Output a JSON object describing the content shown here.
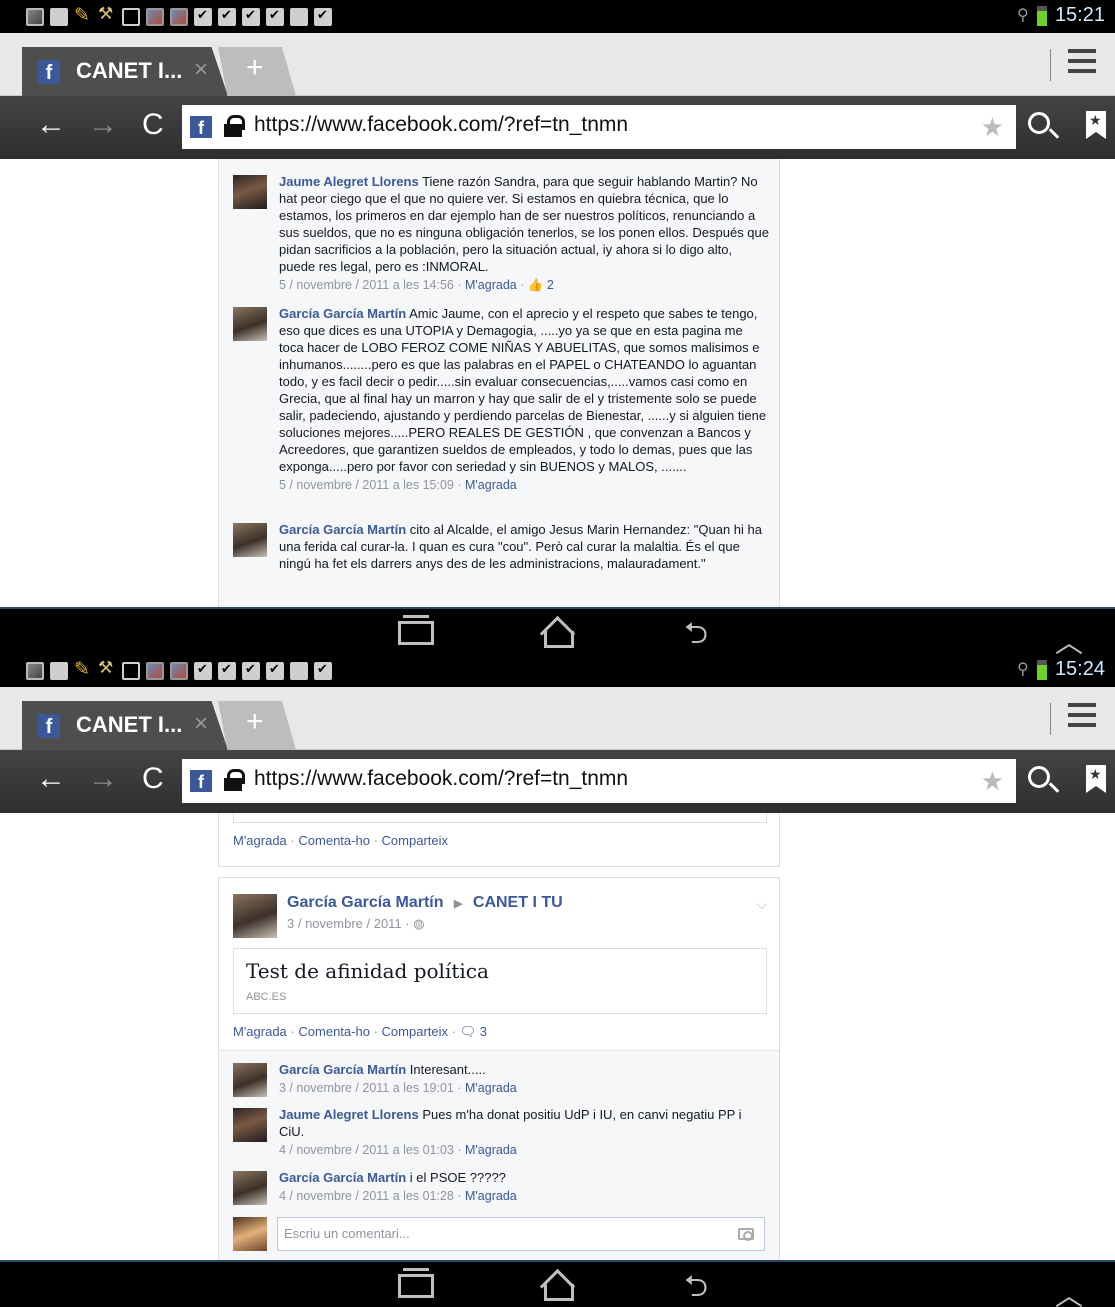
{
  "screens": [
    {
      "status": {
        "time": "15:21"
      },
      "tab": {
        "favicon": "f",
        "title": "CANET I...",
        "close": "×",
        "new": "+"
      },
      "omnibox": {
        "url": "https://www.facebook.com/?ref=tn_tnmn"
      },
      "comments": [
        {
          "author": "Jaume Alegret Llorens",
          "text": "Tiene razón Sandra, para que seguir hablando Martin? No hat peor ciego que el que no quiere ver. Si estamos en quiebra técnica, que lo estamos, los primeros en dar ejemplo han de ser nuestros políticos, renunciando a sus sueldos, que no es ninguna obligación tenerlos, se los ponen ellos. Después que pidan sacrificios a la población, pero la situación actual, iy ahora si lo digo alto, puede res legal, pero es :INMORAL.",
          "date": "5 / novembre / 2011 a les 14:56",
          "like": "M'agrada",
          "likes": "2"
        },
        {
          "author": "García García Martín",
          "text": "Amic Jaume, con el aprecio y el respeto que sabes te tengo, eso que dices es una UTOPIA y Demagogia, .....yo ya se que en esta pagina me toca hacer de LOBO FEROZ COME NIÑAS Y ABUELITAS, que somos malisimos e inhumanos........pero es que las palabras en el PAPEL o CHATEANDO lo aguantan todo, y es facil decir o pedir.....sin evaluar consecuencias,.....vamos casi como en Grecia, que al final hay un marron y hay que salir de el y tristemente solo se puede salir, padeciendo, ajustando y perdiendo parcelas de Bienestar, ......y si alguien tiene soluciones mejores.....PERO REALES DE GESTIÓN , que convenzan a Bancos y Acreedores, que garantizen sueldos de empleados, y todo lo demas, pues que las exponga.....pero por favor con seriedad y sin BUENOS y MALOS, .......",
          "date": "5 / novembre / 2011 a les 15:09",
          "like": "M'agrada"
        },
        {
          "author": "García García Martín",
          "text": "cito al Alcalde, el amigo Jesus Marin Hernandez: \"Quan hi ha una ferida cal curar-la. I quan es cura \"cou\". Però cal curar la malaltia. És el que ningú ha fet els darrers anys des de les administracions, malauradament.\""
        }
      ]
    },
    {
      "status": {
        "time": "15:24"
      },
      "tab": {
        "favicon": "f",
        "title": "CANET I...",
        "close": "×",
        "new": "+"
      },
      "omnibox": {
        "url": "https://www.facebook.com/?ref=tn_tnmn"
      },
      "prev_actions": {
        "like": "M'agrada",
        "comment": "Comenta-ho",
        "share": "Comparteix"
      },
      "post": {
        "author": "García García Martín",
        "group": "CANET I TU",
        "date": "3 / novembre / 2011 ·",
        "link_title": "Test de afinidad política",
        "link_source": "ABC.ES",
        "actions": {
          "like": "M'agrada",
          "comment": "Comenta-ho",
          "share": "Comparteix",
          "comment_count": "3"
        }
      },
      "comments": [
        {
          "author": "García García Martín",
          "text": "Interesant.....",
          "date": "3 / novembre / 2011 a les 19:01",
          "like": "M'agrada"
        },
        {
          "author": "Jaume Alegret Llorens",
          "text": "Pues m'ha donat positiu UdP i IU, en canvi negatiu PP i CiU.",
          "date": "4 / novembre / 2011 a les 01:03",
          "like": "M'agrada"
        },
        {
          "author": "García García Martín",
          "text": "i el PSOE ?????",
          "date": "4 / novembre / 2011 a les 01:28",
          "like": "M'agrada"
        }
      ],
      "comment_input": {
        "placeholder": "Escriu un comentari..."
      }
    }
  ],
  "icons": {
    "back": "←",
    "forward": "→",
    "reload": "C",
    "star": "★",
    "nav_back": "⮌",
    "nav_up": "︿",
    "wifi": "⚲"
  },
  "colors": {
    "facebook_blue": "#3b5998",
    "battery": "#6fd12c"
  }
}
